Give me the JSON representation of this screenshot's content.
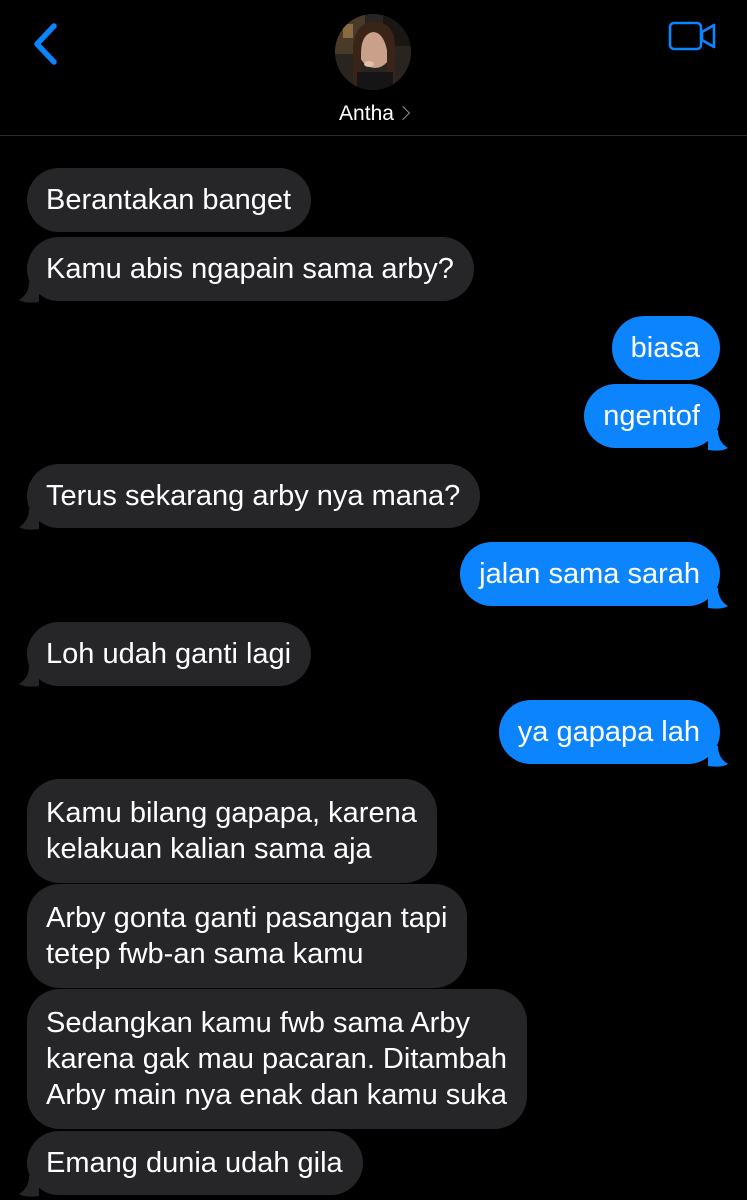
{
  "header": {
    "contact_name": "Antha",
    "back_icon": "chevron-left-icon",
    "video_icon": "video-camera-icon",
    "accent": "#0a84ff"
  },
  "colors": {
    "incoming": "#262629",
    "outgoing": "#0b84fe",
    "background": "#000000"
  },
  "messages": [
    {
      "from": "them",
      "text": "Berantakan banget"
    },
    {
      "from": "them",
      "text": "Kamu abis ngapain sama arby?"
    },
    {
      "from": "me",
      "text": "biasa"
    },
    {
      "from": "me",
      "text": "ngentof"
    },
    {
      "from": "them",
      "text": "Terus sekarang arby nya mana?"
    },
    {
      "from": "me",
      "text": "jalan sama sarah"
    },
    {
      "from": "them",
      "text": "Loh udah ganti lagi"
    },
    {
      "from": "me",
      "text": "ya gapapa lah"
    },
    {
      "from": "them",
      "lines": [
        "Kamu bilang gapapa, karena",
        "kelakuan kalian sama aja"
      ]
    },
    {
      "from": "them",
      "lines": [
        "Arby gonta ganti pasangan tapi",
        "tetep fwb-an sama kamu"
      ]
    },
    {
      "from": "them",
      "lines": [
        "Sedangkan kamu fwb sama Arby",
        "karena gak mau pacaran. Ditambah",
        "Arby main nya enak dan kamu suka"
      ]
    },
    {
      "from": "them",
      "text": "Emang dunia udah gila"
    }
  ]
}
